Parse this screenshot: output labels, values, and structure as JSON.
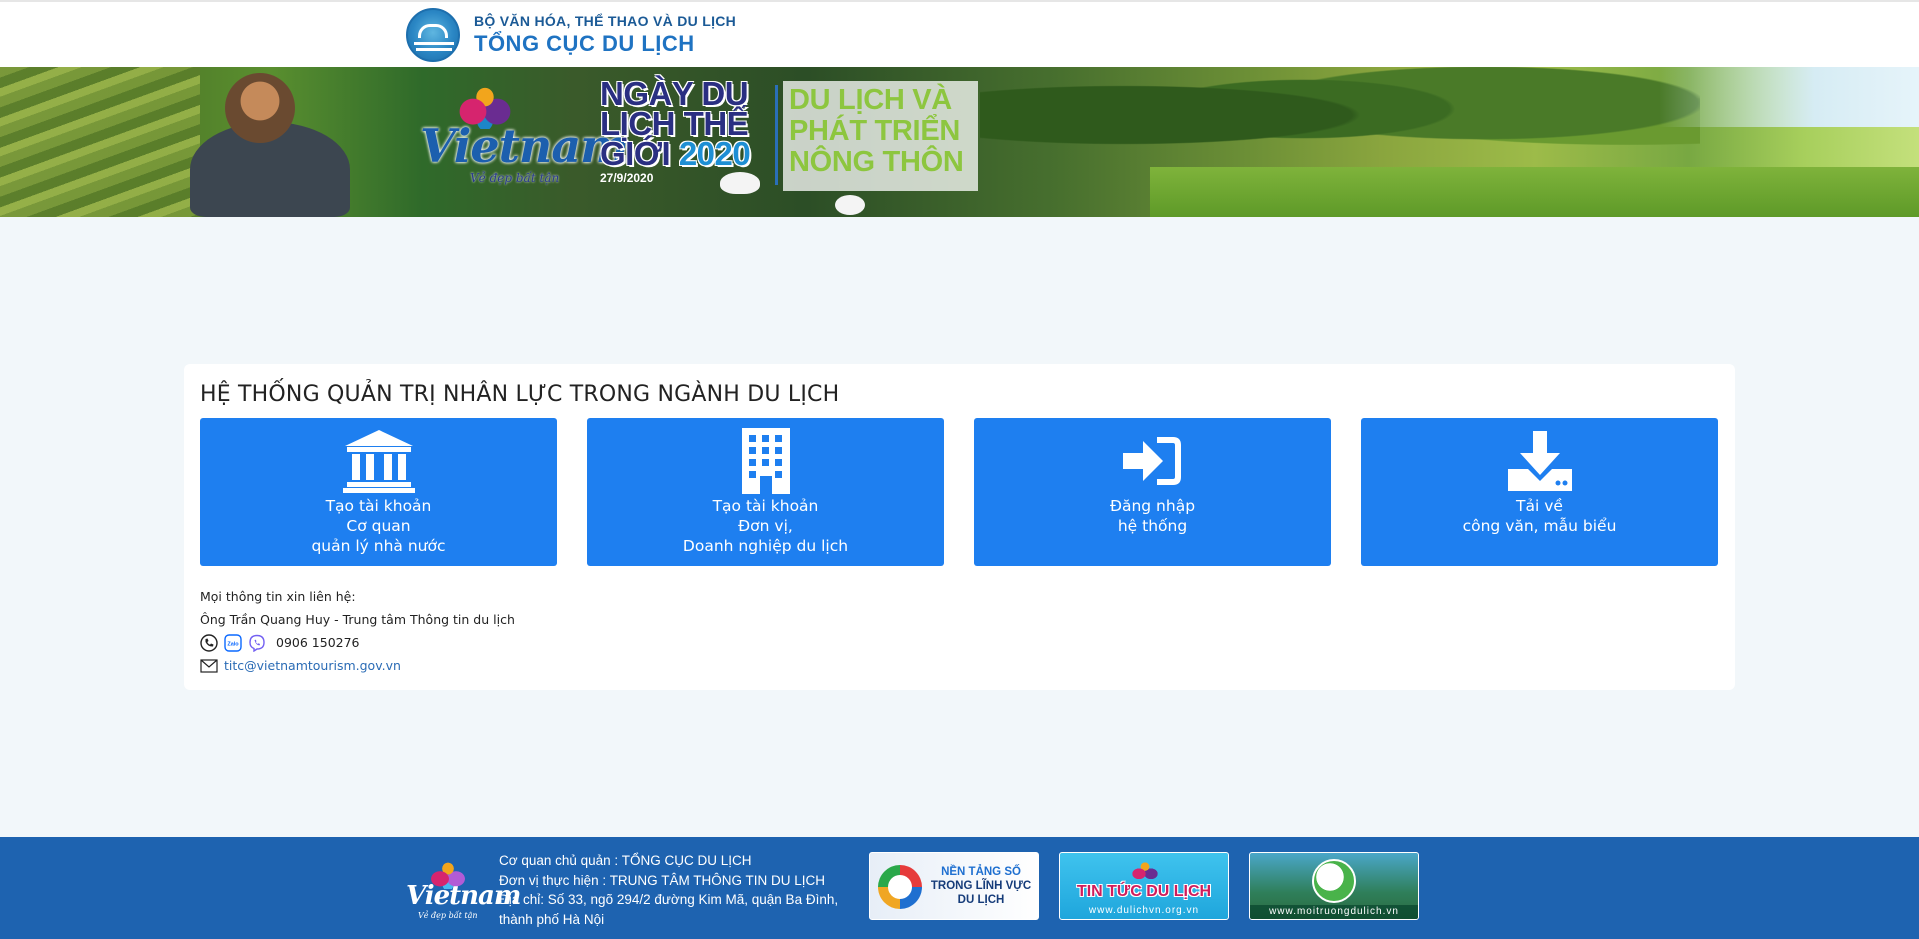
{
  "header": {
    "ministry": "BỘ VĂN HÓA, THỂ THAO VÀ DU LỊCH",
    "agency": "TỔNG CỤC DU LỊCH"
  },
  "banner": {
    "brand_word": "Vietnam",
    "brand_slogan": "Vẻ đẹp bất tận",
    "event_lines": [
      "NGÀY DU",
      "LỊCH THẾ",
      "GIỚI"
    ],
    "event_year": "2020",
    "event_date": "27/9/2020",
    "theme_lines": [
      "DU LỊCH VÀ",
      "PHÁT TRIỂN",
      "NÔNG THÔN"
    ]
  },
  "main": {
    "title": "HỆ THỐNG QUẢN TRỊ NHÂN LỰC TRONG NGÀNH DU LỊCH",
    "tiles": [
      {
        "icon": "landmark-icon",
        "lines": [
          "Tạo tài khoản",
          "Cơ quan",
          "quản lý nhà nước"
        ]
      },
      {
        "icon": "building-icon",
        "lines": [
          "Tạo tài khoản",
          "Đơn vị,",
          "Doanh nghiệp du lịch"
        ]
      },
      {
        "icon": "sign-in-icon",
        "lines": [
          "Đăng nhập",
          "hệ thống"
        ]
      },
      {
        "icon": "download-icon",
        "lines": [
          "Tải về",
          "công văn, mẫu biểu"
        ]
      }
    ],
    "contact": {
      "intro": "Mọi thông tin xin liên hệ:",
      "person": "Ông Trần Quang Huy - Trung tâm Thông tin du lịch",
      "phone": "0906 150276",
      "zalo_label": "Zalo",
      "email": "titc@vietnamtourism.gov.vn"
    }
  },
  "footer": {
    "brand_word": "Vietnam",
    "brand_slogan": "Vẻ đẹp bất tận",
    "info_lines": [
      "Cơ quan chủ quản : TỔNG CỤC DU LỊCH",
      "Đơn vị thực hiện : TRUNG TÂM THÔNG TIN DU LỊCH",
      "Địa chỉ: Số 33, ngõ 294/2 đường Kim Mã, quận Ba Đình,",
      "thành phố Hà Nội"
    ],
    "badges": [
      {
        "lines": [
          "NỀN TẢNG SỐ",
          "TRONG LĨNH VỰC",
          "DU LỊCH"
        ]
      },
      {
        "title": "TIN TỨC DU LỊCH",
        "url_text": "www.dulichvn.org.vn"
      },
      {
        "url_text": "www.moitruongdulich.vn"
      }
    ]
  },
  "colors": {
    "tile_blue": "#1e7ff0",
    "footer_blue": "#1e63b0",
    "page_bg": "#f2f7fa",
    "link": "#2a6bb5"
  }
}
